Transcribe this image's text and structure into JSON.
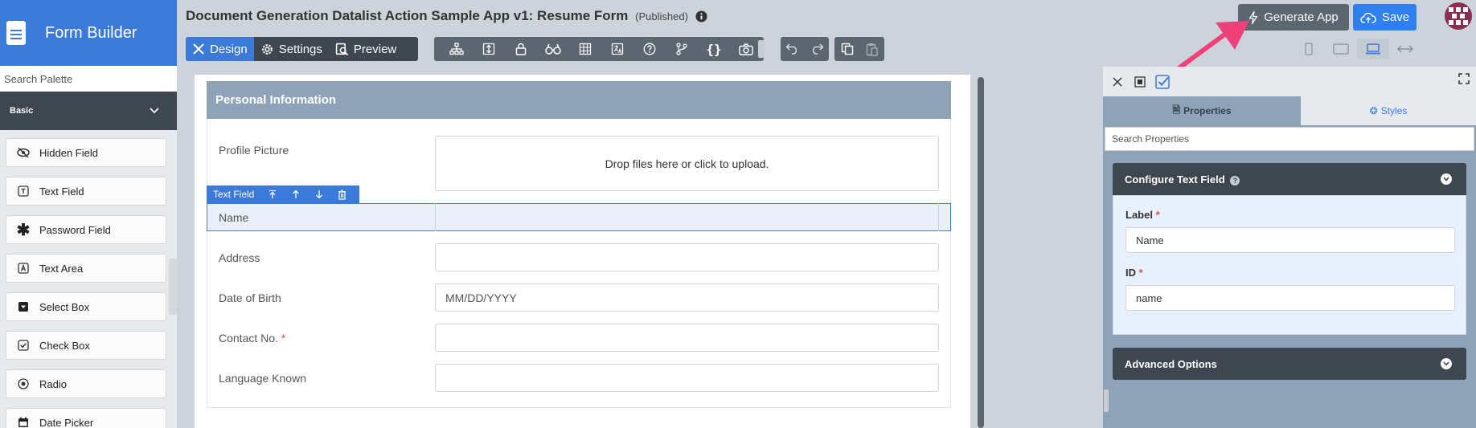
{
  "app": {
    "title": "Form Builder"
  },
  "palette": {
    "search_placeholder": "Search Palette",
    "category": "Basic",
    "items": [
      {
        "label": "Hidden Field",
        "icon": "eye-slash-icon"
      },
      {
        "label": "Text Field",
        "icon": "text-field-icon"
      },
      {
        "label": "Password Field",
        "icon": "asterisk-icon"
      },
      {
        "label": "Text Area",
        "icon": "text-area-icon"
      },
      {
        "label": "Select Box",
        "icon": "select-box-icon"
      },
      {
        "label": "Check Box",
        "icon": "check-box-icon"
      },
      {
        "label": "Radio",
        "icon": "radio-icon"
      },
      {
        "label": "Date Picker",
        "icon": "calendar-icon"
      }
    ]
  },
  "header": {
    "title": "Document Generation Datalist Action Sample App v1: Resume Form",
    "status": "(Published)"
  },
  "toolbar": {
    "design_label": "Design",
    "settings_label": "Settings",
    "preview_label": "Preview",
    "generate_label": "Generate App",
    "save_label": "Save"
  },
  "form": {
    "section_title": "Personal Information",
    "selected_element_label": "Text Field",
    "fields": [
      {
        "label": "Profile Picture",
        "type": "file",
        "value": "Drop files here or click to upload."
      },
      {
        "label": "Name",
        "type": "text",
        "value": ""
      },
      {
        "label": "Address",
        "type": "text",
        "value": ""
      },
      {
        "label": "Date of Birth",
        "type": "date",
        "value": "MM/DD/YYYY"
      },
      {
        "label": "Contact No.",
        "type": "text",
        "value": "",
        "required_mark": "*"
      },
      {
        "label": "Language Known",
        "type": "text",
        "value": ""
      }
    ]
  },
  "properties": {
    "tab_properties": "Properties",
    "tab_styles": "Styles",
    "search_placeholder": "Search Properties",
    "configure_title": "Configure Text Field",
    "label_field_label": "Label",
    "label_value": "Name",
    "id_field_label": "ID",
    "id_value": "name",
    "required_mark": "*",
    "advanced_title": "Advanced Options"
  },
  "colors": {
    "accent": "#3b7ad9",
    "dark": "#3e464f",
    "section": "#8ea3b7",
    "arrow": "#f0407a"
  }
}
